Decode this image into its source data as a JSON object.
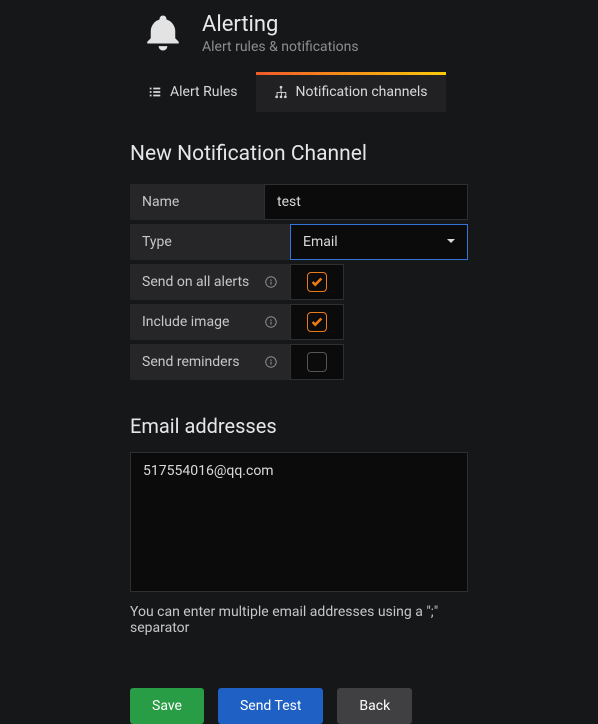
{
  "header": {
    "title": "Alerting",
    "subtitle": "Alert rules & notifications"
  },
  "tabs": [
    {
      "label": "Alert Rules",
      "active": false
    },
    {
      "label": "Notification channels",
      "active": true
    }
  ],
  "form": {
    "title": "New Notification Channel",
    "name_label": "Name",
    "name_value": "test",
    "type_label": "Type",
    "type_value": "Email",
    "send_all_label": "Send on all alerts",
    "send_all_checked": true,
    "include_image_label": "Include image",
    "include_image_checked": true,
    "send_reminders_label": "Send reminders",
    "send_reminders_checked": false
  },
  "email": {
    "section_title": "Email addresses",
    "value": "517554016@qq.com",
    "hint": "You can enter multiple email addresses using a \";\" separator"
  },
  "buttons": {
    "save": "Save",
    "send_test": "Send Test",
    "back": "Back"
  }
}
